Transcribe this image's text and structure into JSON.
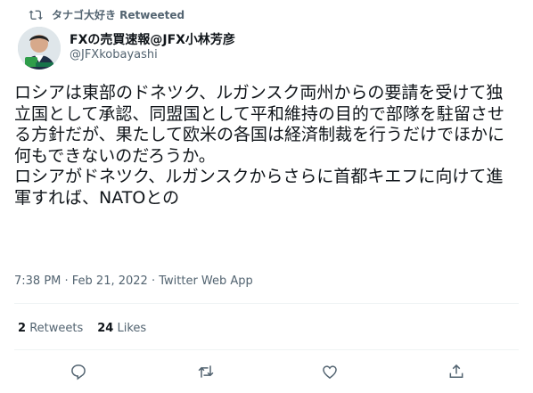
{
  "retweet": {
    "label": "タナゴ大好き Retweeted"
  },
  "author": {
    "name": "FXの売買速報@JFX小林芳彦",
    "handle": "@JFXkobayashi"
  },
  "tweet": {
    "text": "ロシアは東部のドネツク、ルガンスク両州からの要請を受けて独立国として承認、同盟国として平和維持の目的で部隊を駐留させる方針だが、果たして欧米の各国は経済制裁を行うだけでほかに何もできないのだろうか。\nロシアがドネツク、ルガンスクからさらに首都キエフに向けて進軍すれば、NATOとの",
    "timestamp": "7:38 PM · Feb 21, 2022 · Twitter Web App"
  },
  "stats": {
    "retweets_count": "2",
    "retweets_label": "Retweets",
    "likes_count": "24",
    "likes_label": "Likes"
  },
  "actions": {
    "reply_icon": "reply-icon",
    "retweet_icon": "retweet-icon",
    "like_icon": "heart-icon",
    "share_icon": "share-icon"
  },
  "colors": {
    "secondary_text": "#536471",
    "primary_text": "#0f1419",
    "divider": "#eff3f4"
  }
}
